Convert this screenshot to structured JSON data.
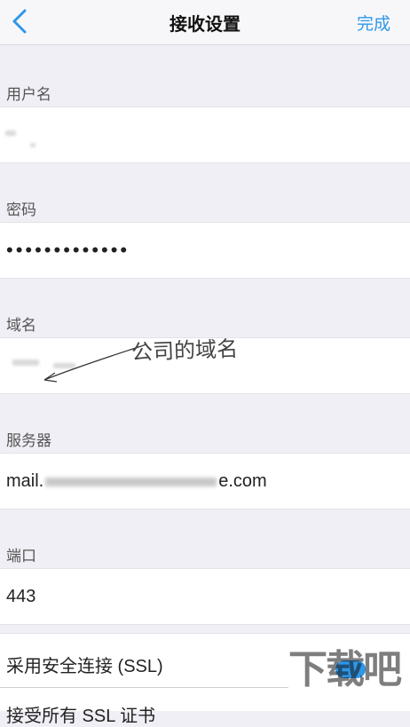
{
  "nav": {
    "title": "接收设置",
    "done_label": "完成"
  },
  "fields": {
    "username": {
      "label": "用户名",
      "value": ""
    },
    "password": {
      "label": "密码",
      "value": "•••••••••••••"
    },
    "domain": {
      "label": "域名",
      "value": "",
      "annotation": "公司的域名"
    },
    "server": {
      "label": "服务器",
      "value_prefix": "mail.",
      "value_suffix": "e.com"
    },
    "port": {
      "label": "端口",
      "value": "443"
    }
  },
  "ssl": {
    "label": "采用安全连接 (SSL)",
    "enabled": true
  },
  "next_row": {
    "label": "接受所有 SSL 证书"
  },
  "watermark": "下载吧",
  "colors": {
    "accent": "#2f97e8",
    "background": "#f0eff5"
  }
}
